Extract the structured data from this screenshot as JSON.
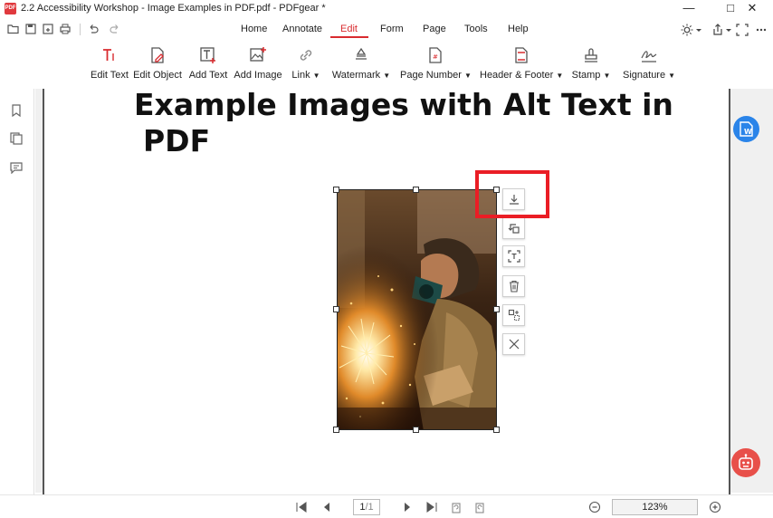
{
  "window": {
    "app_icon_text": "PDF",
    "title": "2.2 Accessibility Workshop - Image Examples in PDF.pdf - PDFgear *"
  },
  "menu": {
    "items": [
      "Home",
      "Annotate",
      "Edit",
      "Form",
      "Page",
      "Tools",
      "Help"
    ],
    "active": "Edit"
  },
  "toolbar": {
    "edit_text": "Edit Text",
    "edit_object": "Edit Object",
    "add_text": "Add Text",
    "add_image": "Add Image",
    "link": "Link",
    "watermark": "Watermark",
    "page_number": "Page Number",
    "header_footer": "Header & Footer",
    "stamp": "Stamp",
    "signature": "Signature"
  },
  "document": {
    "heading_line1": "Example Images with Alt Text in",
    "heading_line2": "PDF"
  },
  "image_tools": [
    "download-icon",
    "replace-icon",
    "ocr-text-icon",
    "delete-icon",
    "crop-icon",
    "close-icon"
  ],
  "status": {
    "current_page": "1",
    "total_pages": "/1",
    "zoom": "123%"
  },
  "colors": {
    "accent": "#d92b2f",
    "highlight_box": "#ea1d25",
    "word_fab": "#2a84e9",
    "assistant_fab": "#e8504a"
  }
}
